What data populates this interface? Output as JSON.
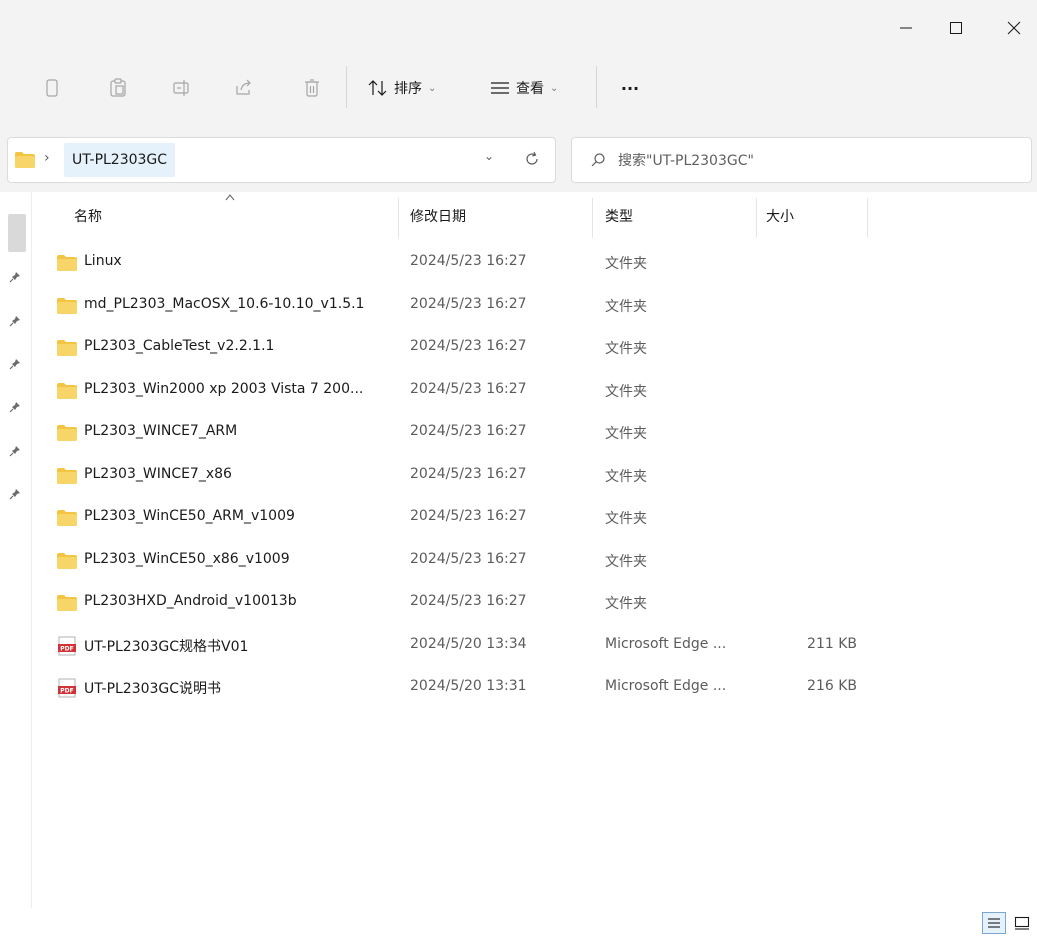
{
  "window": {
    "controls": {
      "minimize": "—",
      "maximize": "□",
      "close": "✕"
    }
  },
  "toolbar": {
    "icons": [
      "copy-icon",
      "paste-icon",
      "rename-icon",
      "share-icon",
      "delete-icon"
    ],
    "sort_label": "排序",
    "view_label": "查看",
    "more_label": "···"
  },
  "address": {
    "breadcrumb": "UT-PL2303GC",
    "search_placeholder": "搜索\"UT-PL2303GC\""
  },
  "columns": {
    "name": "名称",
    "date": "修改日期",
    "type": "类型",
    "size": "大小"
  },
  "files": [
    {
      "icon": "folder-icon",
      "name": "Linux",
      "date": "2024/5/23 16:27",
      "type": "文件夹",
      "size": ""
    },
    {
      "icon": "folder-icon",
      "name": "md_PL2303_MacOSX_10.6-10.10_v1.5.1",
      "date": "2024/5/23 16:27",
      "type": "文件夹",
      "size": ""
    },
    {
      "icon": "folder-icon",
      "name": "PL2303_CableTest_v2.2.1.1",
      "date": "2024/5/23 16:27",
      "type": "文件夹",
      "size": ""
    },
    {
      "icon": "folder-icon",
      "name": "PL2303_Win2000 xp 2003 Vista 7 200...",
      "date": "2024/5/23 16:27",
      "type": "文件夹",
      "size": ""
    },
    {
      "icon": "folder-icon",
      "name": "PL2303_WINCE7_ARM",
      "date": "2024/5/23 16:27",
      "type": "文件夹",
      "size": ""
    },
    {
      "icon": "folder-icon",
      "name": "PL2303_WINCE7_x86",
      "date": "2024/5/23 16:27",
      "type": "文件夹",
      "size": ""
    },
    {
      "icon": "folder-icon",
      "name": "PL2303_WinCE50_ARM_v1009",
      "date": "2024/5/23 16:27",
      "type": "文件夹",
      "size": ""
    },
    {
      "icon": "folder-icon",
      "name": "PL2303_WinCE50_x86_v1009",
      "date": "2024/5/23 16:27",
      "type": "文件夹",
      "size": ""
    },
    {
      "icon": "folder-icon",
      "name": "PL2303HXD_Android_v10013b",
      "date": "2024/5/23 16:27",
      "type": "文件夹",
      "size": ""
    },
    {
      "icon": "pdf-icon",
      "name": "UT-PL2303GC规格书V01",
      "date": "2024/5/20 13:34",
      "type": "Microsoft Edge ...",
      "size": "211 KB"
    },
    {
      "icon": "pdf-icon",
      "name": "UT-PL2303GC说明书",
      "date": "2024/5/20 13:31",
      "type": "Microsoft Edge ...",
      "size": "216 KB"
    }
  ],
  "colors": {
    "chrome_bg": "#f3f3f3",
    "folder_yellow": "#f4c542",
    "pdf_red": "#d13438",
    "selection_blue": "#e5f1fb"
  }
}
